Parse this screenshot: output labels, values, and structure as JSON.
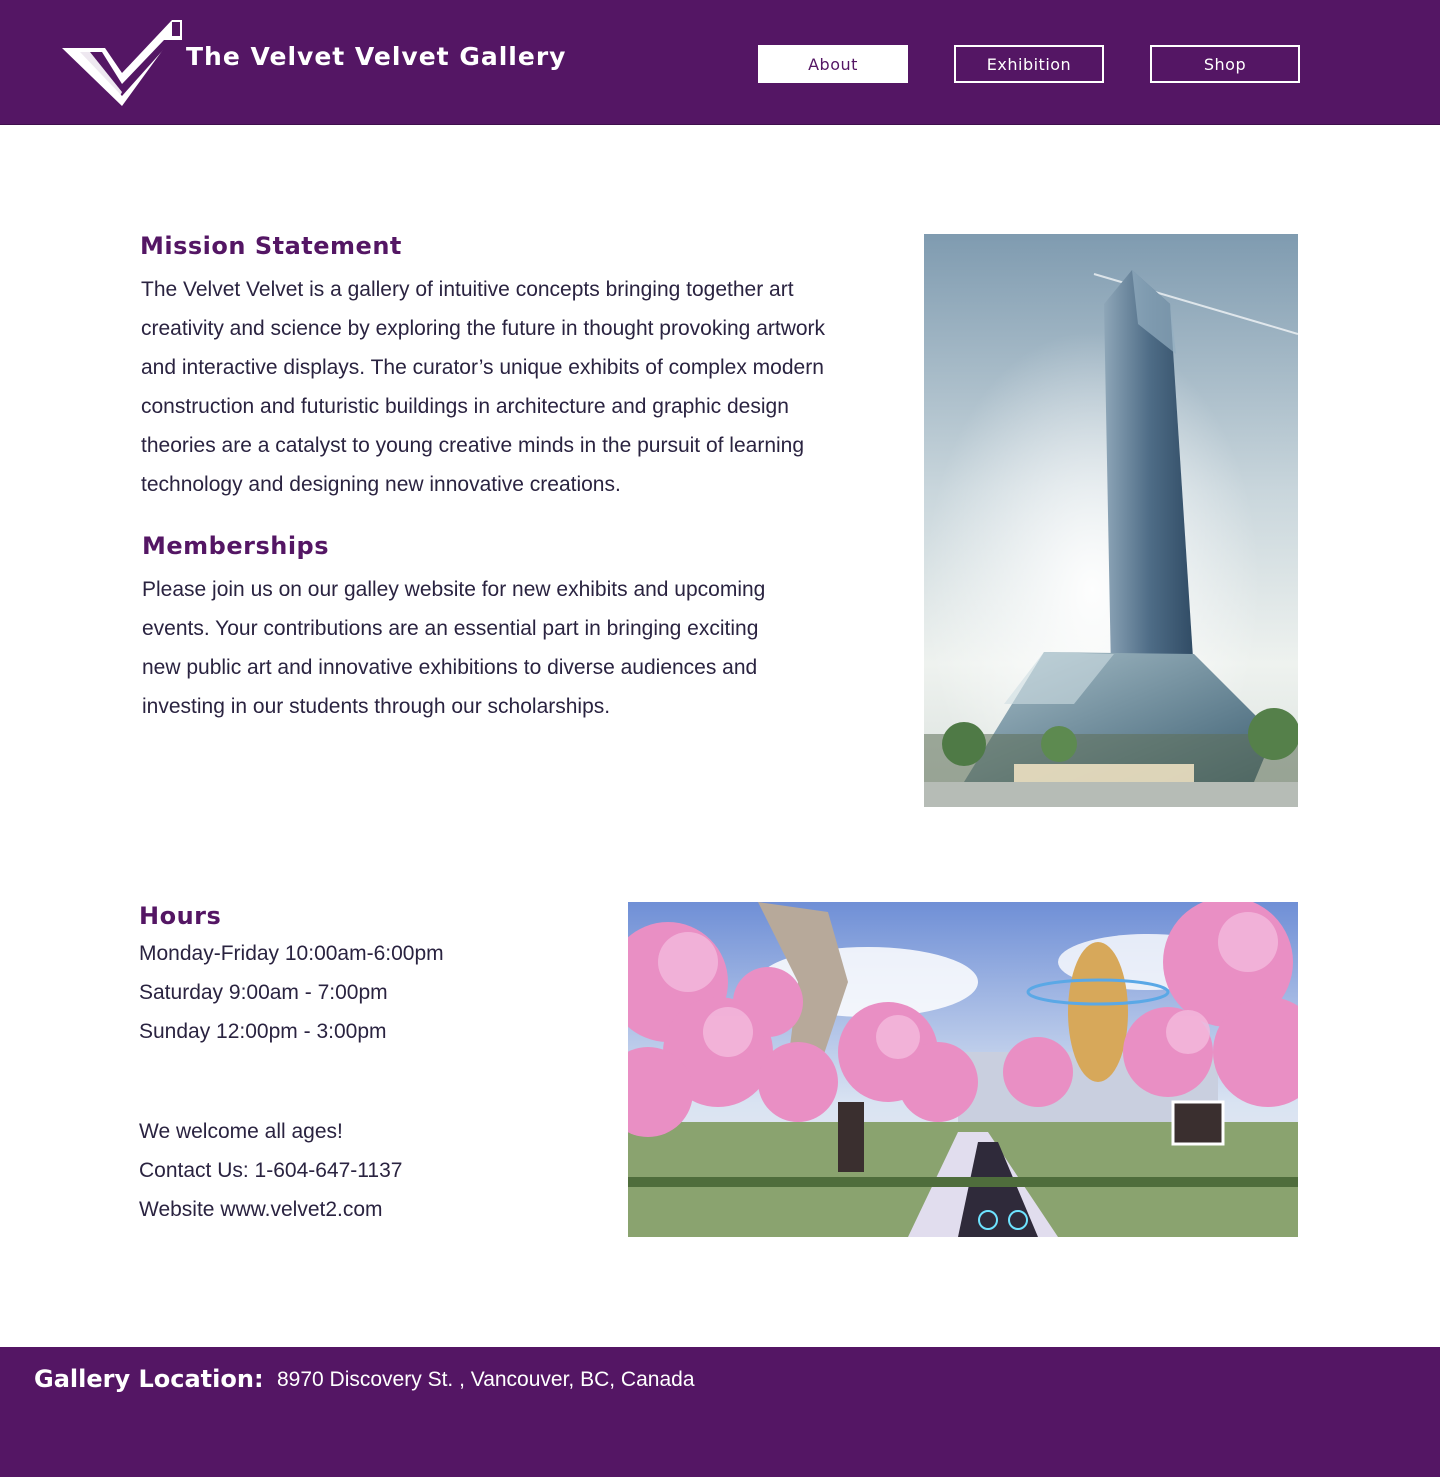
{
  "header": {
    "title": "The Velvet Velvet Gallery",
    "logo_icon": "velvet-v-logo",
    "nav": [
      {
        "label": "About",
        "active": true
      },
      {
        "label": "Exhibition",
        "active": false
      },
      {
        "label": "Shop",
        "active": false
      }
    ]
  },
  "mission": {
    "heading": "Mission Statement",
    "lines": [
      "The Velvet Velvet is a gallery of intuitive concepts bringing together art",
      "creativity and science by exploring the future in thought provoking artwork",
      "and interactive displays. The curator’s unique exhibits of complex modern",
      "construction and futuristic buildings in architecture and graphic design",
      "theories are a catalyst to young creative minds in the pursuit of learning",
      "technology and designing new innovative creations."
    ]
  },
  "memberships": {
    "heading": "Memberships",
    "lines": [
      "Please join us on our galley website for new exhibits and upcoming",
      "events. Your contributions are an essential part in bringing exciting",
      "new public art and innovative exhibitions to diverse audiences and",
      "investing in our students through our scholarships."
    ]
  },
  "hours": {
    "heading": "Hours",
    "lines": [
      "Monday-Friday 10:00am-6:00pm",
      "Saturday 9:00am - 7:00pm",
      "Sunday 12:00pm - 3:00pm"
    ]
  },
  "info": {
    "lines": [
      "We welcome all ages!",
      "Contact Us: 1-604-647-1137",
      "Website www.velvet2.com"
    ]
  },
  "footer": {
    "label": "Gallery Location:",
    "address": "8970 Discovery St. , Vancouver, BC, Canada"
  },
  "colors": {
    "brand_purple": "#541664",
    "white": "#ffffff",
    "text": "#2a2340"
  }
}
